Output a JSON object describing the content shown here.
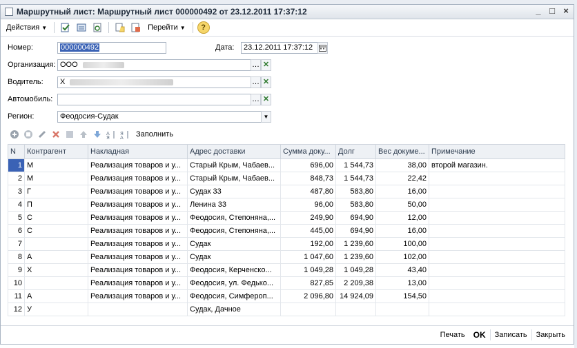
{
  "window": {
    "title": "Маршрутный лист: Маршрутный лист 000000492 от 23.12.2011 17:37:12",
    "buttons": [
      "_",
      "□",
      "×"
    ]
  },
  "toolbar": {
    "actions_label": "Действия",
    "goto_label": "Перейти",
    "help_glyph": "?"
  },
  "form": {
    "number_label": "Номер:",
    "number_value": "000000492",
    "date_label": "Дата:",
    "date_value": "23.12.2011 17:37:12",
    "org_label": "Организация:",
    "org_value": "ООО",
    "driver_label": "Водитель:",
    "driver_value": "Х",
    "car_label": "Автомобиль:",
    "car_value": "",
    "region_label": "Регион:",
    "region_value": "Феодосия-Судак"
  },
  "table_toolbar": {
    "fill_label": "Заполнить"
  },
  "table": {
    "columns": [
      "N",
      "Контрагент",
      "Накладная",
      "Адрес доставки",
      "Сумма доку...",
      "Долг",
      "Вес докуме...",
      "Примечание"
    ],
    "rows": [
      {
        "n": "1",
        "counterparty": "М",
        "invoice": "Реализация товаров и у...",
        "address": "Старый Крым, Чабаев...",
        "sum": "696,00",
        "debt": "1 544,73",
        "weight": "38,00",
        "note": "второй магазин."
      },
      {
        "n": "2",
        "counterparty": "М",
        "invoice": "Реализация товаров и у...",
        "address": "Старый Крым, Чабаев...",
        "sum": "848,73",
        "debt": "1 544,73",
        "weight": "22,42",
        "note": ""
      },
      {
        "n": "3",
        "counterparty": "Г",
        "invoice": "Реализация товаров и у...",
        "address": "Судак 33",
        "sum": "487,80",
        "debt": "583,80",
        "weight": "16,00",
        "note": ""
      },
      {
        "n": "4",
        "counterparty": "П",
        "invoice": "Реализация товаров и у...",
        "address": "Ленина 33",
        "sum": "96,00",
        "debt": "583,80",
        "weight": "50,00",
        "note": ""
      },
      {
        "n": "5",
        "counterparty": "С",
        "invoice": "Реализация товаров и у...",
        "address": "Феодосия, Степоняна,...",
        "sum": "249,90",
        "debt": "694,90",
        "weight": "12,00",
        "note": ""
      },
      {
        "n": "6",
        "counterparty": "С",
        "invoice": "Реализация товаров и у...",
        "address": "Феодосия, Степоняна,...",
        "sum": "445,00",
        "debt": "694,90",
        "weight": "16,00",
        "note": ""
      },
      {
        "n": "7",
        "counterparty": "",
        "invoice": "Реализация товаров и у...",
        "address": "Судак",
        "sum": "192,00",
        "debt": "1 239,60",
        "weight": "100,00",
        "note": ""
      },
      {
        "n": "8",
        "counterparty": "А",
        "invoice": "Реализация товаров и у...",
        "address": "Судак",
        "sum": "1 047,60",
        "debt": "1 239,60",
        "weight": "102,00",
        "note": ""
      },
      {
        "n": "9",
        "counterparty": "Х",
        "invoice": "Реализация товаров и у...",
        "address": "Феодосия, Керченско...",
        "sum": "1 049,28",
        "debt": "1 049,28",
        "weight": "43,40",
        "note": ""
      },
      {
        "n": "10",
        "counterparty": "",
        "invoice": "Реализация товаров и у...",
        "address": "Феодосия, ул. Федько...",
        "sum": "827,85",
        "debt": "2 209,38",
        "weight": "13,00",
        "note": ""
      },
      {
        "n": "11",
        "counterparty": "А",
        "invoice": "Реализация товаров и у...",
        "address": "Феодосия, Симфероп...",
        "sum": "2 096,80",
        "debt": "14 924,09",
        "weight": "154,50",
        "note": ""
      },
      {
        "n": "12",
        "counterparty": "У",
        "invoice": "",
        "address": "Судак, Дачное",
        "sum": "",
        "debt": "",
        "weight": "",
        "note": ""
      }
    ]
  },
  "footer": {
    "print_label": "Печать",
    "ok_label": "OK",
    "save_label": "Записать",
    "close_label": "Закрыть"
  }
}
